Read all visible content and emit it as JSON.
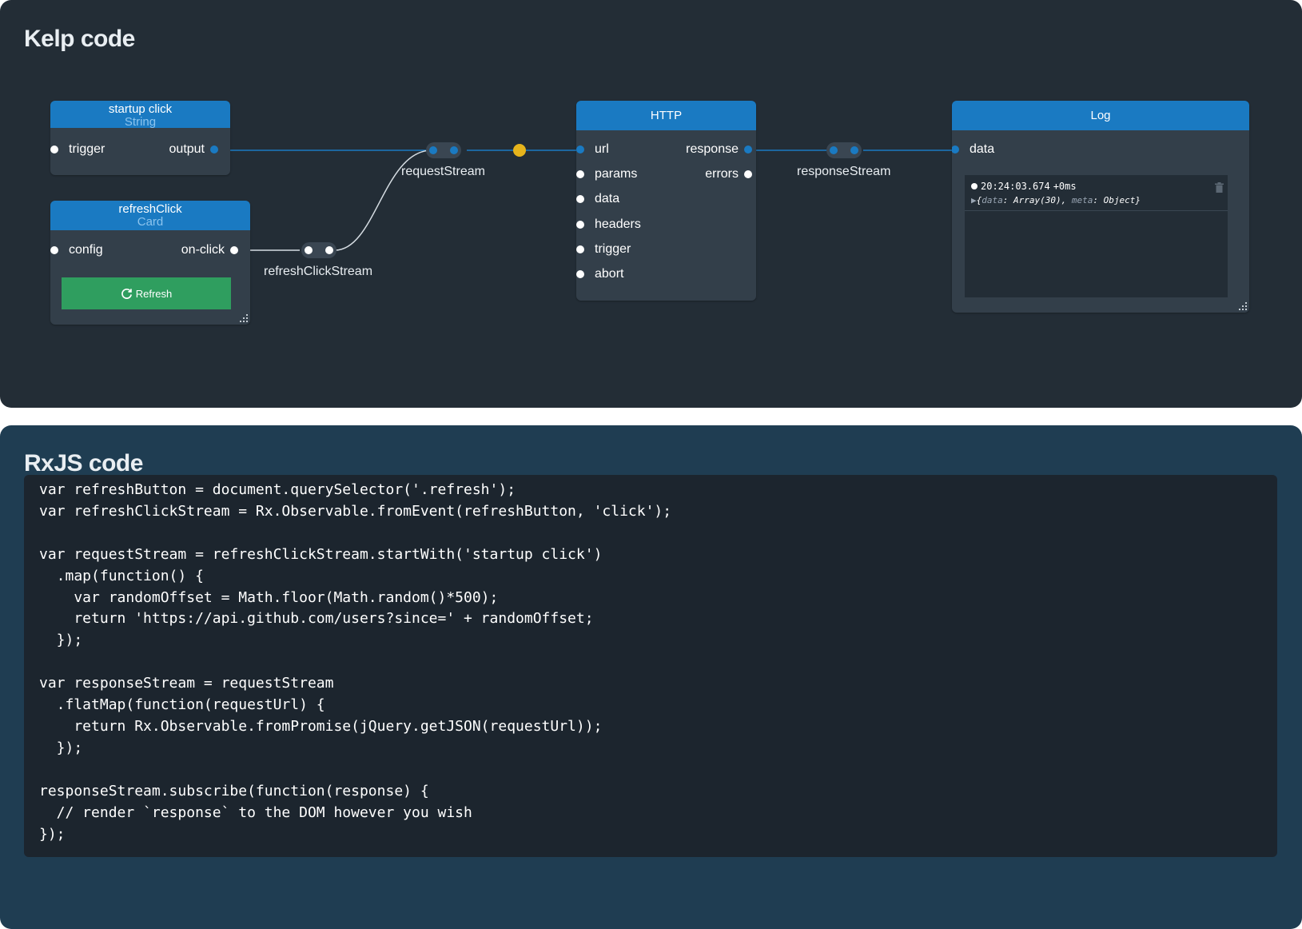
{
  "kelp": {
    "title": "Kelp code",
    "nodes": {
      "startup": {
        "title": "startup click",
        "subtitle": "String",
        "inputs": [
          "trigger"
        ],
        "outputs": [
          "output"
        ]
      },
      "refresh": {
        "title": "refreshClick",
        "subtitle": "Card",
        "inputs": [
          "config"
        ],
        "outputs": [
          "on-click"
        ],
        "button_label": "Refresh"
      },
      "http": {
        "title": "HTTP",
        "inputs": [
          "url",
          "params",
          "data",
          "headers",
          "trigger",
          "abort"
        ],
        "outputs": [
          "response",
          "errors"
        ]
      },
      "log": {
        "title": "Log",
        "inputs": [
          "data"
        ],
        "entry_time": "20:24:03.674",
        "entry_delta": "+0ms",
        "entry_open": "{",
        "entry_key1": "data",
        "entry_val1": ": Array(30), ",
        "entry_key2": "meta",
        "entry_val2": ": Object}"
      }
    },
    "streams": {
      "request": "requestStream",
      "response": "responseStream",
      "refresh_click": "refreshClickStream"
    },
    "colors": {
      "accent": "#1a7ac2",
      "active_dot": "#e6b41c",
      "button": "#2f9e5f"
    }
  },
  "rxjs": {
    "title": "RxJS code",
    "code": "var refreshButton = document.querySelector('.refresh');\nvar refreshClickStream = Rx.Observable.fromEvent(refreshButton, 'click');\n\nvar requestStream = refreshClickStream.startWith('startup click')\n  .map(function() {\n    var randomOffset = Math.floor(Math.random()*500);\n    return 'https://api.github.com/users?since=' + randomOffset;\n  });\n\nvar responseStream = requestStream\n  .flatMap(function(requestUrl) {\n    return Rx.Observable.fromPromise(jQuery.getJSON(requestUrl));\n  });\n\nresponseStream.subscribe(function(response) {\n  // render `response` to the DOM however you wish\n});"
  }
}
